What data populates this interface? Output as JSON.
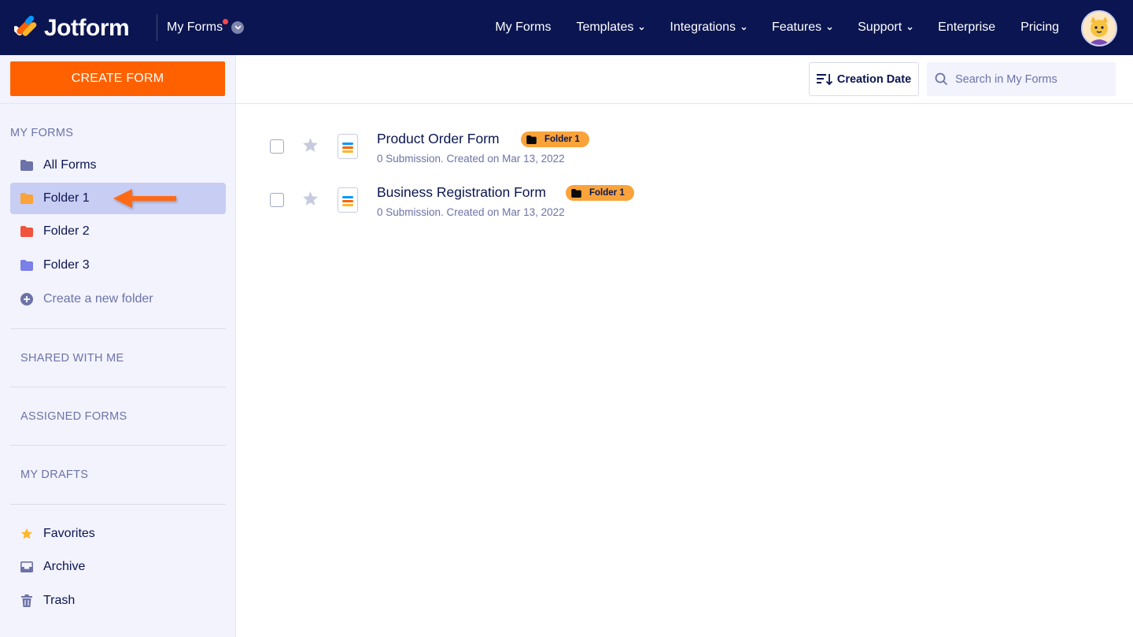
{
  "app": {
    "brand": "Jotform",
    "switcher_label": "My Forms",
    "nav": [
      {
        "label": "My Forms",
        "dropdown": false
      },
      {
        "label": "Templates",
        "dropdown": true
      },
      {
        "label": "Integrations",
        "dropdown": true
      },
      {
        "label": "Features",
        "dropdown": true
      },
      {
        "label": "Support",
        "dropdown": true
      },
      {
        "label": "Enterprise",
        "dropdown": false
      },
      {
        "label": "Pricing",
        "dropdown": false
      }
    ]
  },
  "sidebar": {
    "create_label": "CREATE FORM",
    "my_forms_title": "MY FORMS",
    "items": [
      {
        "label": "All Forms",
        "color": "#6c73a8"
      },
      {
        "label": "Folder 1",
        "color": "#f9a33a",
        "active": true
      },
      {
        "label": "Folder 2",
        "color": "#f0543c"
      },
      {
        "label": "Folder 3",
        "color": "#7b7fe8"
      }
    ],
    "new_folder_label": "Create a new folder",
    "sections": [
      "SHARED WITH ME",
      "ASSIGNED FORMS",
      "MY DRAFTS"
    ],
    "bottom_items": [
      "Favorites",
      "Archive",
      "Trash"
    ]
  },
  "toolbar": {
    "sort_label": "Creation Date",
    "search_placeholder": "Search in My Forms"
  },
  "forms": [
    {
      "title": "Product Order Form",
      "folder": "Folder 1",
      "meta": "0 Submission. Created on Mar 13, 2022"
    },
    {
      "title": "Business Registration Form",
      "folder": "Folder 1",
      "meta": "0 Submission. Created on Mar 13, 2022"
    }
  ],
  "colors": {
    "navbar": "#0a1551",
    "accent": "#ff6100",
    "folder_badge": "#f9a33a",
    "sidebar_bg": "#f3f3fe",
    "active_item": "#c8cdf3"
  }
}
